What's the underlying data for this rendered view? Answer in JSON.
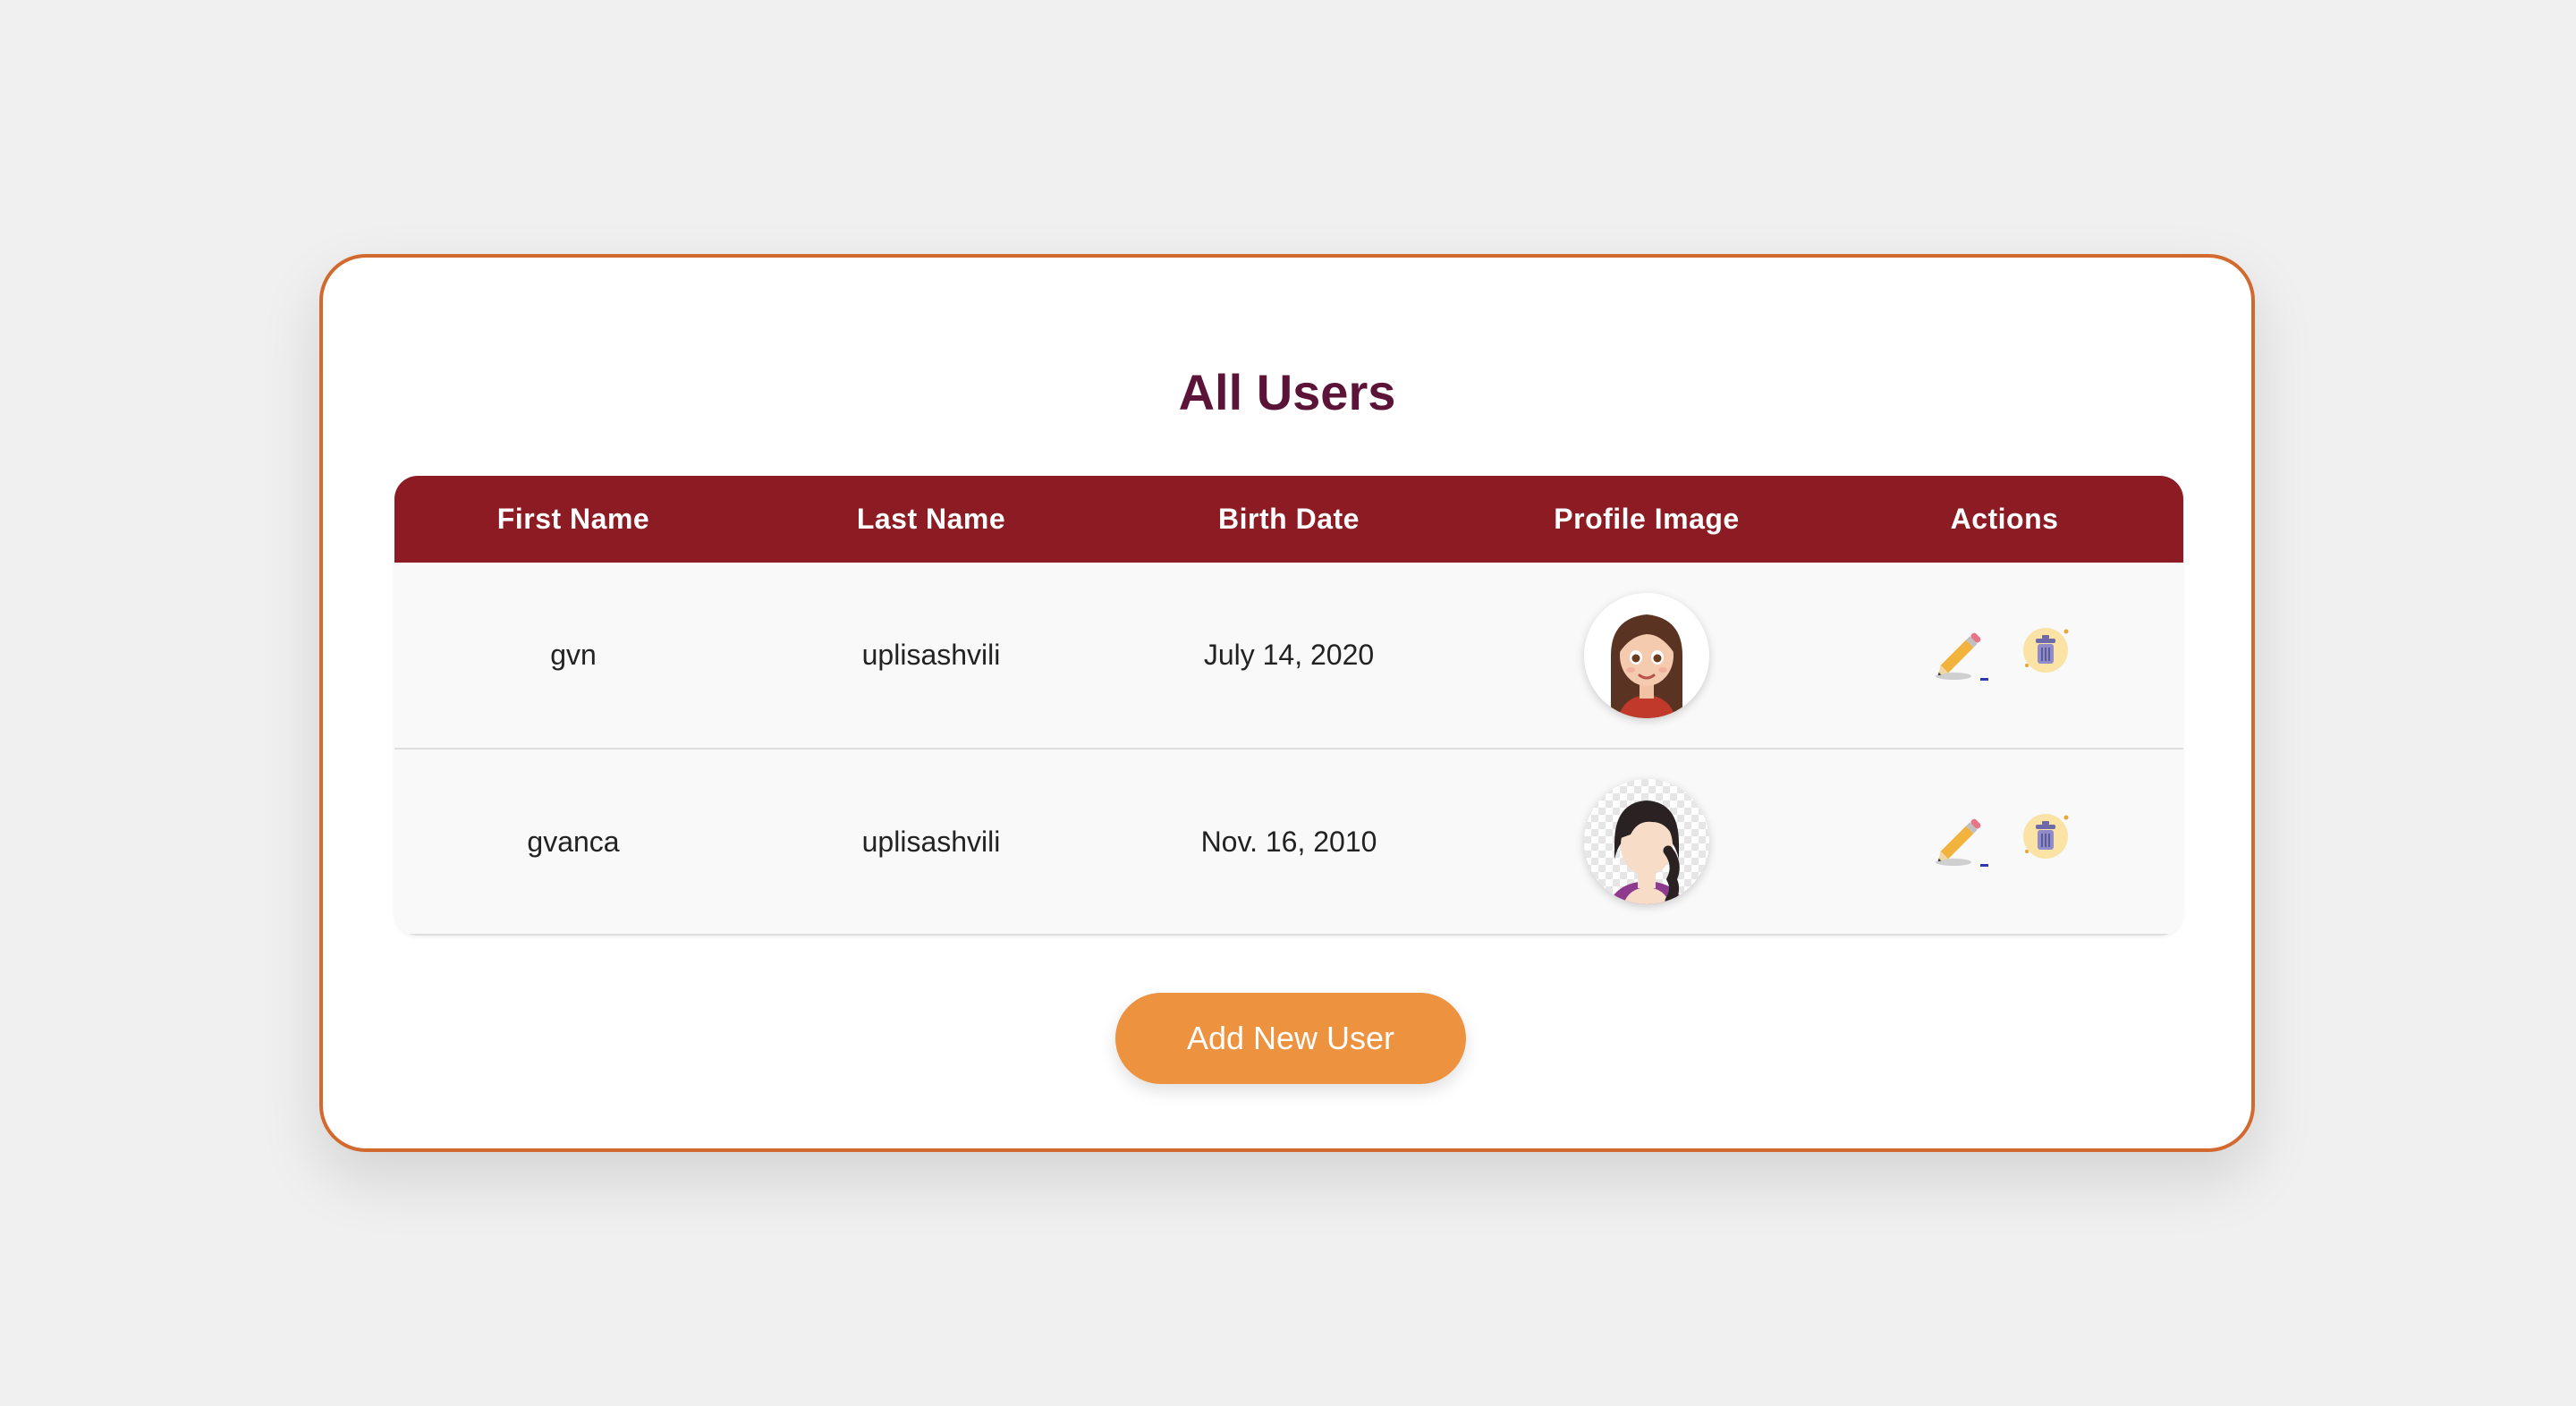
{
  "page": {
    "title": "All Users",
    "add_button_label": "Add New User"
  },
  "table": {
    "headers": [
      "First Name",
      "Last Name",
      "Birth Date",
      "Profile Image",
      "Actions"
    ],
    "rows": [
      {
        "first_name": "gvn",
        "last_name": "uplisashvili",
        "birth_date": "July 14, 2020",
        "avatar": "cartoon-girl-avatar"
      },
      {
        "first_name": "gvanca",
        "last_name": "uplisashvili",
        "birth_date": "Nov. 16, 2010",
        "avatar": "default-female-avatar"
      }
    ],
    "action_icons": [
      "pencil-icon",
      "trash-icon"
    ]
  },
  "colors": {
    "background": "#f0f0f0",
    "card_border": "#d2692f",
    "title": "#5c1338",
    "header_bg": "#8c1b24",
    "button_bg": "#ed923f"
  }
}
